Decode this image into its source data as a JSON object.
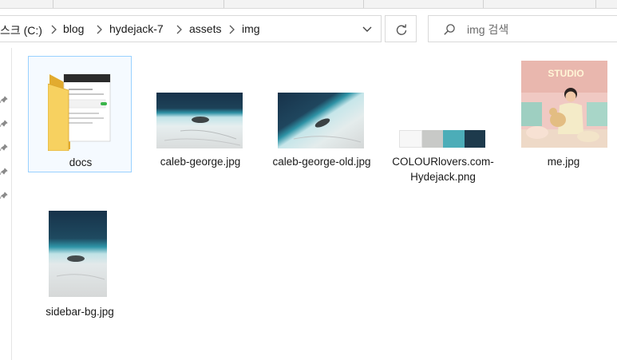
{
  "address_bar": {
    "crumbs": [
      "스크 (C:)",
      "blog",
      "hydejack-7",
      "assets",
      "img"
    ]
  },
  "search": {
    "placeholder": "img 검색"
  },
  "files": [
    {
      "name": "docs",
      "type": "folder",
      "selected": true
    },
    {
      "name": "caleb-george.jpg",
      "type": "image"
    },
    {
      "name": "caleb-george-old.jpg",
      "type": "image"
    },
    {
      "name": "COLOURlovers.com-Hydejack.png",
      "type": "image",
      "swatches": [
        "#f7f7f7",
        "#c8c9c7",
        "#4cadb8",
        "#1d3a4c"
      ]
    },
    {
      "name": "me.jpg",
      "type": "image",
      "thumb_text": "STUDIO"
    },
    {
      "name": "sidebar-bg.jpg",
      "type": "image"
    }
  ],
  "colors": {
    "selection_border": "#99d1ff",
    "folder": "#f5c84f"
  }
}
